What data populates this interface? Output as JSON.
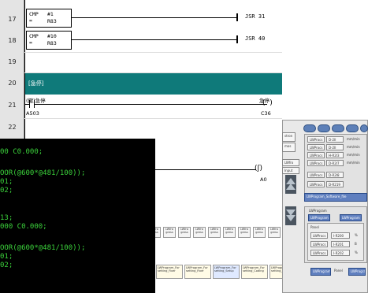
{
  "ladder": {
    "rows": [
      "17",
      "18",
      "19",
      "20",
      "21",
      "22"
    ],
    "rung17": {
      "op": "CMP",
      "cond": "=",
      "a": "#1",
      "b": "R83",
      "jsr": "JSR 31"
    },
    "rung18": {
      "op": "CMP",
      "cond": "=",
      "a": "#10",
      "b": "R83",
      "jsr": "JSR 40"
    },
    "section_title": "[急停]",
    "rung21": {
      "label_left": "(鍵)急停",
      "addr_left": "A503",
      "label_right": "急停",
      "addr_right": "C36"
    },
    "rung_bottom_right": "A0"
  },
  "console": {
    "lines": [
      "00 C0.000;",
      "OOR(@600*@481/100));",
      "01;",
      "02;",
      "13;",
      "000 C0.000;",
      "OOR(@600*@481/100));",
      "01;",
      "02;"
    ]
  },
  "toolbar": {
    "buttons": [
      "LWfro\ngress",
      "LWfro\ngress",
      "LWfro\ngress",
      "LWfro\ngress",
      "LWfro\ngress",
      "LWfro\ngress",
      "LWfro\ngress",
      "LWfro\ngress",
      "LWfro\ngress"
    ]
  },
  "tasks": {
    "items": [
      "LWProgram_For\nsetting_Fixer",
      "LWProgram_For\nsetting_Fixer",
      "LWProgram_For\nsetting_Setup",
      "LWProgram_For\nsetting_Coding",
      "LWProgram_For\nsetting_SetTool"
    ]
  },
  "right_panel": {
    "mid_labels": [
      "stron",
      "mos",
      "LWfro",
      "Input"
    ],
    "row_labels": [
      "LWProcs",
      "LWProcs",
      "LWProcs",
      "LWProcs",
      "LWProcs",
      "LWProcs"
    ],
    "row_values": [
      "D-2II",
      "D-2II",
      "H-R2I3",
      "D-R2I7",
      "D-R2I8",
      "D-R219"
    ],
    "row_units": [
      "mm/min",
      "mm/min",
      "mm/min",
      "mm/min"
    ],
    "program_label": "LWProgram_Software_file",
    "lower_title": "LWProgram",
    "lower_buttons": [
      "LWProgram",
      "LWProgram"
    ],
    "lower_sub": "Panel",
    "lower_rows": [
      {
        "label": "LWProcs",
        "value": "I-R200",
        "unit": "%"
      },
      {
        "label": "LWProcs",
        "value": "I-R201",
        "unit": "B"
      },
      {
        "label": "LWProcs",
        "value": "I-R202",
        "unit": "%"
      }
    ],
    "bottom_buttons": [
      "LWProgram",
      "Panel",
      "LWProgram"
    ],
    "colors": {
      "cap": "#5d80b8",
      "panel": "#f0f0f0",
      "teal": "#0f7a7a",
      "console_text": "#3bd13b"
    }
  }
}
